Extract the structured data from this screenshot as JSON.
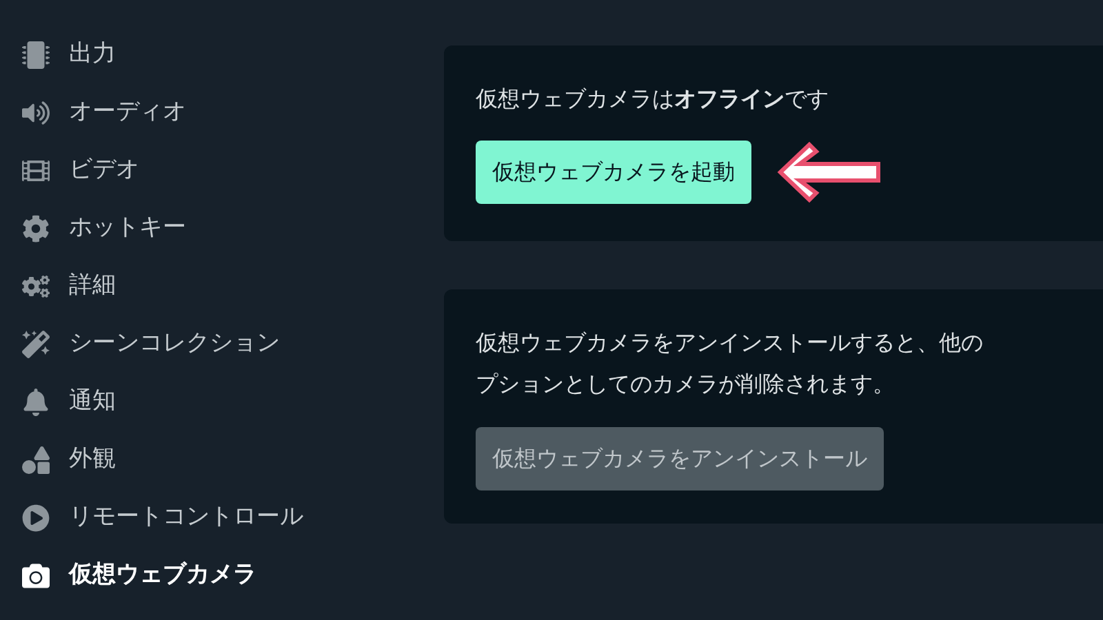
{
  "sidebar": {
    "items": [
      {
        "label": "出力",
        "kind": "chip",
        "selected": false
      },
      {
        "label": "オーディオ",
        "kind": "speaker",
        "selected": false
      },
      {
        "label": "ビデオ",
        "kind": "film",
        "selected": false
      },
      {
        "label": "ホットキー",
        "kind": "gear",
        "selected": false
      },
      {
        "label": "詳細",
        "kind": "gears",
        "selected": false
      },
      {
        "label": "シーンコレクション",
        "kind": "wand",
        "selected": false
      },
      {
        "label": "通知",
        "kind": "bell",
        "selected": false
      },
      {
        "label": "外観",
        "kind": "shapes",
        "selected": false
      },
      {
        "label": "リモートコントロール",
        "kind": "play",
        "selected": false
      },
      {
        "label": "仮想ウェブカメラ",
        "kind": "camera",
        "selected": true
      }
    ]
  },
  "status_card": {
    "message": "仮想ウェブカメラは**オフライン**です",
    "button": "仮想ウェブカメラを起動"
  },
  "uninstall_card": {
    "description_lines": [
      "仮想ウェブカメラをアンインストールすると、他の",
      "プションとしてのカメラが削除されます。"
    ],
    "button": "仮想ウェブカメラをアンインストール",
    "button_disabled": true
  }
}
